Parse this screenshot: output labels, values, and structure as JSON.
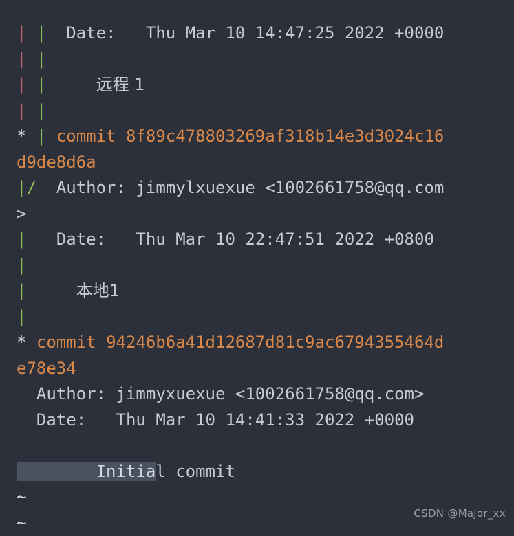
{
  "terminal": {
    "background_color": "#2b303b",
    "foreground_color": "#c5cad3",
    "graph_colors": {
      "branch_red": "#bf616a",
      "branch_green": "#8fbc52",
      "commit_marker": "#c5cad3",
      "hash": "#d9884a",
      "selection_background": "#4a5161"
    },
    "pager_empty_marker": "~"
  },
  "lines": {
    "l1_graph": "| |",
    "l1_label": "Date:",
    "l1_value": "Thu Mar 10 14:47:25 2022 +0000",
    "l2_graph": "| |",
    "l3_graph": "| |",
    "l3_message": "远程 1",
    "l4_graph": "| |",
    "l5_marker": "*",
    "l5_bar": "|",
    "l5_commit_word": "commit",
    "l5_hash_part1": "8f89c478803269af318b14e3d3024c16",
    "l6_hash_part2": "d9de8d6a",
    "l7_graph": "|/",
    "l7_label": "Author:",
    "l7_value": "jimmylxuexue <1002661758@qq.com",
    "l8_value": ">",
    "l9_graph": "|",
    "l9_label": "Date:",
    "l9_value": "Thu Mar 10 22:47:51 2022 +0800",
    "l10_graph": "|",
    "l11_graph": "|",
    "l11_message": "本地1",
    "l12_graph": "|",
    "l13_marker": "*",
    "l13_commit_word": "commit",
    "l13_hash_part1": "94246b6a41d12687d81c9ac6794355464d",
    "l14_hash_part2": "e78e34",
    "l15_label": "Author:",
    "l15_value": "jimmyxuexue <1002661758@qq.com>",
    "l16_label": "Date:",
    "l16_value": "Thu Mar 10 14:41:33 2022 +0000",
    "l18_message_selected": "        Initia",
    "l18_message_rest": "l commit",
    "l19_tilde": "~",
    "l20_tilde": "~"
  },
  "watermark": {
    "text": "CSDN @Major_xx"
  },
  "commits": [
    {
      "hash": "8f89c478803269af318b14e3d3024c16d9de8d6a",
      "author_name": "jimmylxuexue",
      "author_email": "1002661758@qq.com",
      "date": "Thu Mar 10 22:47:51 2022 +0800",
      "message": "本地1"
    },
    {
      "hash": "94246b6a41d12687d81c9ac6794355464de78e34",
      "author_name": "jimmyxuexue",
      "author_email": "1002661758@qq.com",
      "date": "Thu Mar 10 14:41:33 2022 +0000",
      "message": "Initial commit"
    }
  ],
  "partial_commit_above": {
    "date": "Thu Mar 10 14:47:25 2022 +0000",
    "message": "远程 1"
  }
}
